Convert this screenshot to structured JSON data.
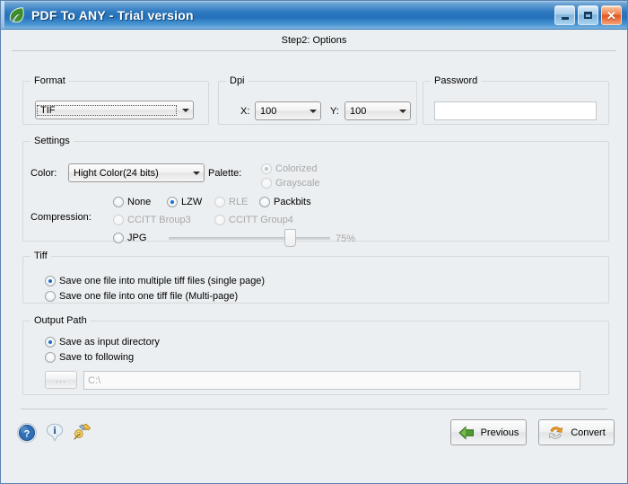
{
  "window": {
    "title": "PDF To ANY - Trial version",
    "app_icon": "leaf-icon",
    "minimize_label": "",
    "maximize_label": "",
    "close_label": "✕"
  },
  "step_header": "Step2: Options",
  "format": {
    "legend": "Format",
    "value": "TIF"
  },
  "dpi": {
    "legend": "Dpi",
    "x_label": "X:",
    "x_value": "100",
    "y_label": "Y:",
    "y_value": "100"
  },
  "password": {
    "legend": "Password",
    "value": "",
    "placeholder": ""
  },
  "settings": {
    "legend": "Settings",
    "color_label": "Color:",
    "color_value": "Hight Color(24 bits)",
    "palette_label": "Palette:",
    "palette_options": [
      {
        "label": "Colorized",
        "checked": true,
        "disabled": true
      },
      {
        "label": "Grayscale",
        "checked": false,
        "disabled": true
      }
    ],
    "compression_label": "Compression:",
    "compression_options": [
      {
        "label": "None",
        "checked": false,
        "disabled": false
      },
      {
        "label": "LZW",
        "checked": true,
        "disabled": false
      },
      {
        "label": "RLE",
        "checked": false,
        "disabled": true
      },
      {
        "label": "Packbits",
        "checked": false,
        "disabled": false
      },
      {
        "label": "CCITT Broup3",
        "checked": false,
        "disabled": true
      },
      {
        "label": "CCITT Group4",
        "checked": false,
        "disabled": true
      },
      {
        "label": "JPG",
        "checked": false,
        "disabled": false
      }
    ],
    "quality_value": "75%",
    "quality_percent": 75
  },
  "tiff": {
    "legend": "Tiff",
    "options": [
      {
        "label": "Save one file into multiple tiff files (single page)",
        "checked": true
      },
      {
        "label": "Save one file into one tiff file (Multi-page)",
        "checked": false
      }
    ]
  },
  "output_path": {
    "legend": "Output Path",
    "options": [
      {
        "label": "Save as input directory",
        "checked": true
      },
      {
        "label": "Save to following",
        "checked": false
      }
    ],
    "browse_label": "...",
    "path_value": "C:\\"
  },
  "toolbar": {
    "help_icon": "help-icon",
    "info_icon": "info-icon",
    "register_icon": "key-icon",
    "previous_label": "Previous",
    "convert_label": "Convert"
  },
  "colors": {
    "title_bar": "#2472bb",
    "accent_selected": "#1a6fc4",
    "background": "#eceff1",
    "close_button": "#e4531d"
  }
}
